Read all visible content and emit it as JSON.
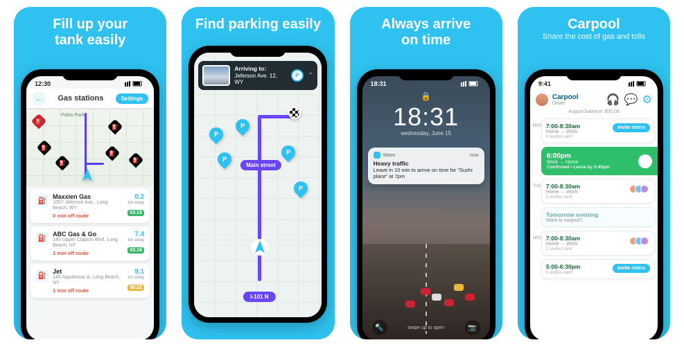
{
  "panels": [
    {
      "title": "Fill up your\ntank easily",
      "subtitle": ""
    },
    {
      "title": "Find parking easily",
      "subtitle": ""
    },
    {
      "title": "Always arrive\non time",
      "subtitle": ""
    },
    {
      "title": "Carpool",
      "subtitle": "Share the cost of gas and tolls"
    }
  ],
  "screen1": {
    "status_time": "12:30",
    "header_title": "Gas stations",
    "settings": "Settings",
    "park_label": "Palos Park",
    "stations": [
      {
        "name": "Maxxien Gas",
        "address": "1057 Jeferson Ave., Long Beach, WY",
        "off": "0 min off route",
        "dist": "0.2",
        "unit": "km away",
        "price": "03.15",
        "price_cls": ""
      },
      {
        "name": "ABC Gas & Go",
        "address": "145 Upper Clapton Blvd, Long Beach, NY",
        "off": "1 min off route",
        "dist": "7.4",
        "unit": "km away",
        "price": "03.16",
        "price_cls": ""
      },
      {
        "name": "Jet",
        "address": "145 Appaloosa st, Long Beach, NY",
        "off": "1 min off route",
        "dist": "9.1",
        "unit": "km away",
        "price": "05.22",
        "price_cls": "yellow"
      }
    ]
  },
  "screen2": {
    "arriving_label": "Arriving to:",
    "arriving_addr": "Jeferson Ave. 12, WY",
    "street": "Main street",
    "highway": "I-101 N"
  },
  "screen3": {
    "status_time": "18:31",
    "clock": "18:31",
    "date": "wednesday, June 15",
    "app": "Waze",
    "when": "now",
    "notif_title": "Heavy traffic",
    "notif_body": "Leave in 10 min to arrive on time for \"Sushi place\" at 7pm",
    "swipe": "swipe up to open"
  },
  "screen4": {
    "status_time": "9:41",
    "title": "Carpool",
    "role": "Driver",
    "balance": "August balance: $50.00",
    "days": [
      "MON",
      "TUE",
      "WED"
    ],
    "cards": [
      {
        "type": "std",
        "time": "7:00-8:30am",
        "route": "Home → Work",
        "sub": "0 invites sent",
        "cta": "Invite riders"
      },
      {
        "type": "green",
        "time": "6:00pm",
        "route": "Work → Home",
        "sub": "Confirmed • Leave by 5:45pm"
      },
      {
        "type": "av",
        "time": "7:00-8:30am",
        "route": "Home → Work",
        "sub": "2 invites sent"
      },
      {
        "type": "ghost",
        "time": "Tomorrow evening",
        "route": "Want to carpool?"
      },
      {
        "type": "av",
        "time": "7:00-8:30am",
        "route": "Home → Work",
        "sub": "2 invites sent"
      },
      {
        "type": "std",
        "time": "5:00-6:30pm",
        "route": "",
        "sub": "0 invites sent",
        "cta": "Invite riders"
      }
    ]
  }
}
